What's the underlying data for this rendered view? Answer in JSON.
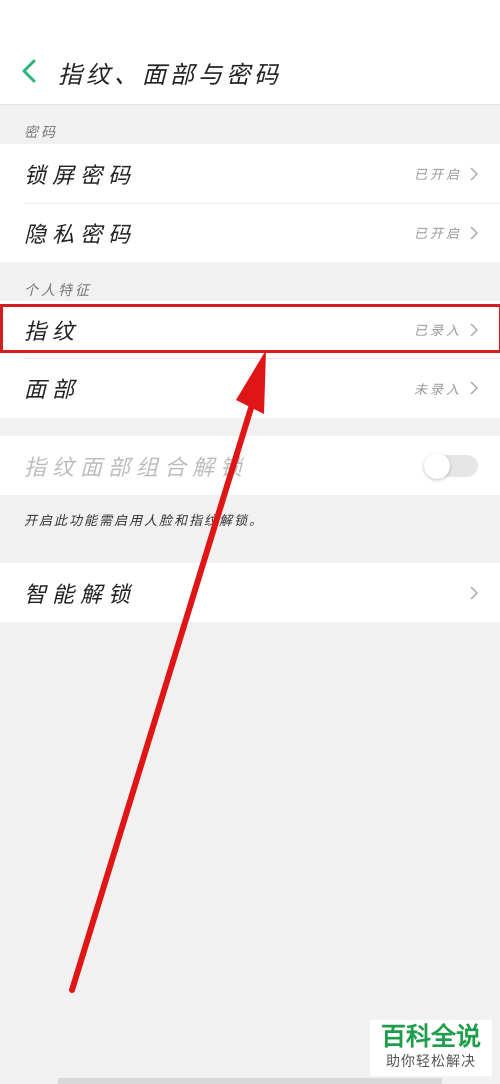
{
  "header": {
    "title": "指纹、面部与密码"
  },
  "sections": {
    "password": {
      "label": "密码",
      "items": [
        {
          "label": "锁屏密码",
          "value": "已开启"
        },
        {
          "label": "隐私密码",
          "value": "已开启"
        }
      ]
    },
    "personal": {
      "label": "个人特征",
      "items": [
        {
          "label": "指纹",
          "value": "已录入"
        },
        {
          "label": "面部",
          "value": "未录入"
        }
      ]
    },
    "combo": {
      "label": "指纹面部组合解锁",
      "toggle_on": false,
      "hint": "开启此功能需启用人脸和指纹解锁。"
    },
    "smart": {
      "label": "智能解锁"
    }
  },
  "annotation": {
    "highlight_color": "#d41f1f",
    "arrow_color": "#e01515"
  },
  "watermark": {
    "title": "百科全说",
    "subtitle": "助你轻松解决"
  }
}
